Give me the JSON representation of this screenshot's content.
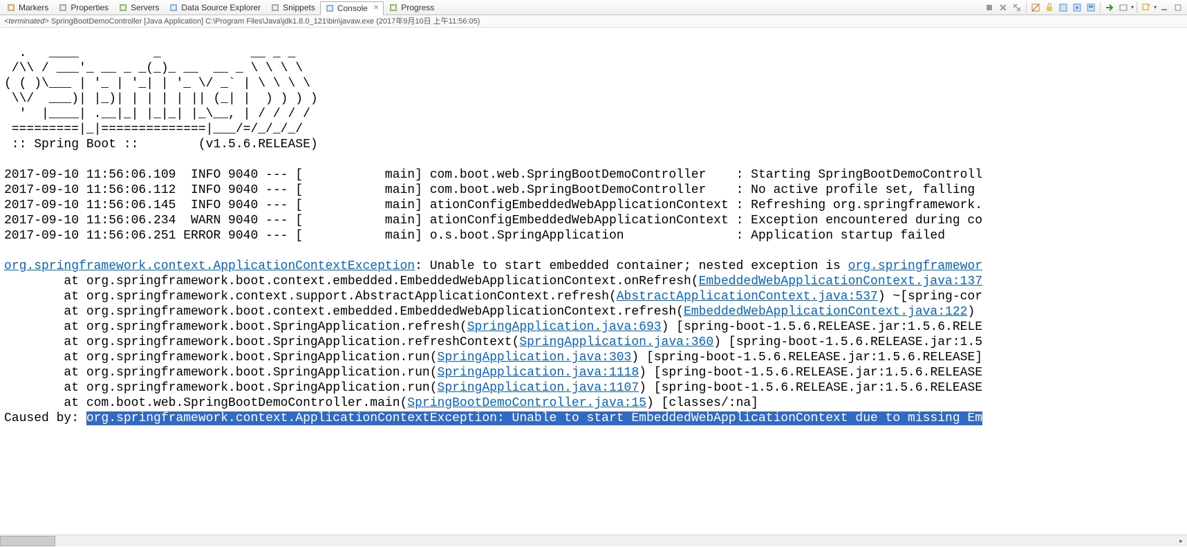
{
  "tabs": [
    {
      "label": "Markers",
      "icon": "markers",
      "active": false
    },
    {
      "label": "Properties",
      "icon": "properties",
      "active": false
    },
    {
      "label": "Servers",
      "icon": "servers",
      "active": false
    },
    {
      "label": "Data Source Explorer",
      "icon": "datasource",
      "active": false
    },
    {
      "label": "Snippets",
      "icon": "snippets",
      "active": false
    },
    {
      "label": "Console",
      "icon": "console",
      "active": true,
      "closable": true
    },
    {
      "label": "Progress",
      "icon": "progress",
      "active": false
    }
  ],
  "status": {
    "prefix": "<terminated>",
    "app": "SpringBootDemoController [Java Application]",
    "path": "C:\\Program Files\\Java\\jdk1.8.0_121\\bin\\javaw.exe",
    "time": "(2017年9月10日 上午11:56:05)"
  },
  "banner": [
    "",
    "  .   ____          _            __ _ _",
    " /\\\\ / ___'_ __ _ _(_)_ __  __ _ \\ \\ \\ \\",
    "( ( )\\___ | '_ | '_| | '_ \\/ _` | \\ \\ \\ \\",
    " \\\\/  ___)| |_)| | | | | || (_| |  ) ) ) )",
    "  '  |____| .__|_| |_|_| |_\\__, | / / / /",
    " =========|_|==============|___/=/_/_/_/",
    " :: Spring Boot ::        (v1.5.6.RELEASE)",
    ""
  ],
  "logs": [
    "2017-09-10 11:56:06.109  INFO 9040 --- [           main] com.boot.web.SpringBootDemoController    : Starting SpringBootDemoControll",
    "2017-09-10 11:56:06.112  INFO 9040 --- [           main] com.boot.web.SpringBootDemoController    : No active profile set, falling ",
    "2017-09-10 11:56:06.145  INFO 9040 --- [           main] ationConfigEmbeddedWebApplicationContext : Refreshing org.springframework.",
    "2017-09-10 11:56:06.234  WARN 9040 --- [           main] ationConfigEmbeddedWebApplicationContext : Exception encountered during co",
    "2017-09-10 11:56:06.251 ERROR 9040 --- [           main] o.s.boot.SpringApplication               : Application startup failed",
    ""
  ],
  "trace": {
    "ex_link1": "org.springframework.context.ApplicationContextException",
    "ex_msg": ": Unable to start embedded container; nested exception is ",
    "ex_link2": "org.springframewor",
    "lines": [
      {
        "pre": "        at org.springframework.boot.context.embedded.EmbeddedWebApplicationContext.onRefresh(",
        "link": "EmbeddedWebApplicationContext.java:137",
        "post": ""
      },
      {
        "pre": "        at org.springframework.context.support.AbstractApplicationContext.refresh(",
        "link": "AbstractApplicationContext.java:537",
        "post": ") ~[spring-cor"
      },
      {
        "pre": "        at org.springframework.boot.context.embedded.EmbeddedWebApplicationContext.refresh(",
        "link": "EmbeddedWebApplicationContext.java:122",
        "post": ") "
      },
      {
        "pre": "        at org.springframework.boot.SpringApplication.refresh(",
        "link": "SpringApplication.java:693",
        "post": ") [spring-boot-1.5.6.RELEASE.jar:1.5.6.RELE"
      },
      {
        "pre": "        at org.springframework.boot.SpringApplication.refreshContext(",
        "link": "SpringApplication.java:360",
        "post": ") [spring-boot-1.5.6.RELEASE.jar:1.5"
      },
      {
        "pre": "        at org.springframework.boot.SpringApplication.run(",
        "link": "SpringApplication.java:303",
        "post": ") [spring-boot-1.5.6.RELEASE.jar:1.5.6.RELEASE]"
      },
      {
        "pre": "        at org.springframework.boot.SpringApplication.run(",
        "link": "SpringApplication.java:1118",
        "post": ") [spring-boot-1.5.6.RELEASE.jar:1.5.6.RELEASE"
      },
      {
        "pre": "        at org.springframework.boot.SpringApplication.run(",
        "link": "SpringApplication.java:1107",
        "post": ") [spring-boot-1.5.6.RELEASE.jar:1.5.6.RELEASE"
      },
      {
        "pre": "        at com.boot.web.SpringBootDemoController.main(",
        "link": "SpringBootDemoController.java:15",
        "post": ") [classes/:na]"
      }
    ],
    "caused_pre": "Caused by: ",
    "caused_sel": "org.springframework.context.ApplicationContextException: Unable to start EmbeddedWebApplicationContext due to missing Em"
  },
  "icons": {
    "markers": "#b88f2a",
    "properties": "#888",
    "servers": "#6a9e3f",
    "datasource": "#5b8fd6",
    "snippets": "#888",
    "console": "#5b8fd6",
    "progress": "#6a9e3f"
  }
}
